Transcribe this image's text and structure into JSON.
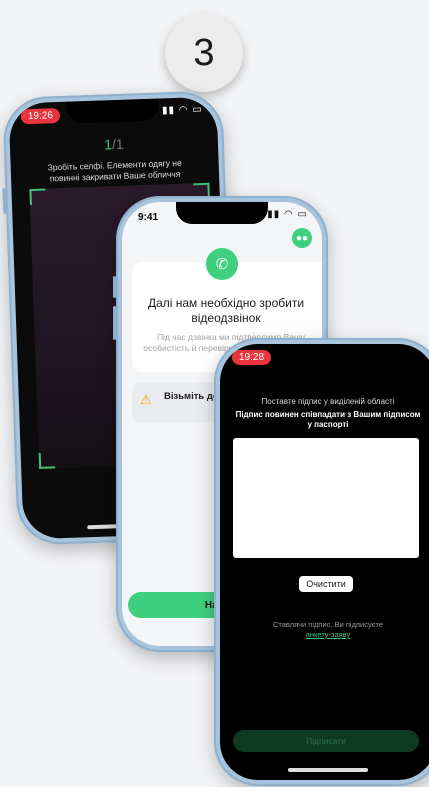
{
  "step": {
    "number": "3"
  },
  "phone1": {
    "time": "19:26",
    "counter_active": "1",
    "counter_total": "/1",
    "instruction": "Зробіть селфі. Елементи одягу не повинні закривати Ваше обличчя"
  },
  "phone2": {
    "time": "9:41",
    "title": "Далі нам необхідно зробити відеодзвінок",
    "description": "Під час дзвінка ми підтвердимо Вашу особистість й перевіримо ... Перевірка зай...",
    "warning": "Візьміть доку... проходили р...",
    "start_button": "Начат..."
  },
  "phone3": {
    "time": "19:28",
    "instruction": "Поставте підпис у виділеній області",
    "instruction_bold": "Підпис повинен співпадати з Вашим підписом у паспорті",
    "clear_button": "Очистити",
    "note_prefix": "Ставлячи підпис, Ви підписуєте",
    "note_link": "анкету-заяву",
    "sign_button": "Підписати"
  },
  "colors": {
    "accent": "#3fd07f",
    "time_pill": "#e8343a",
    "frame": "#a8c4dc"
  },
  "icons": [
    "phone-icon",
    "chat-icon",
    "warning-icon",
    "wifi-icon",
    "battery-icon"
  ]
}
